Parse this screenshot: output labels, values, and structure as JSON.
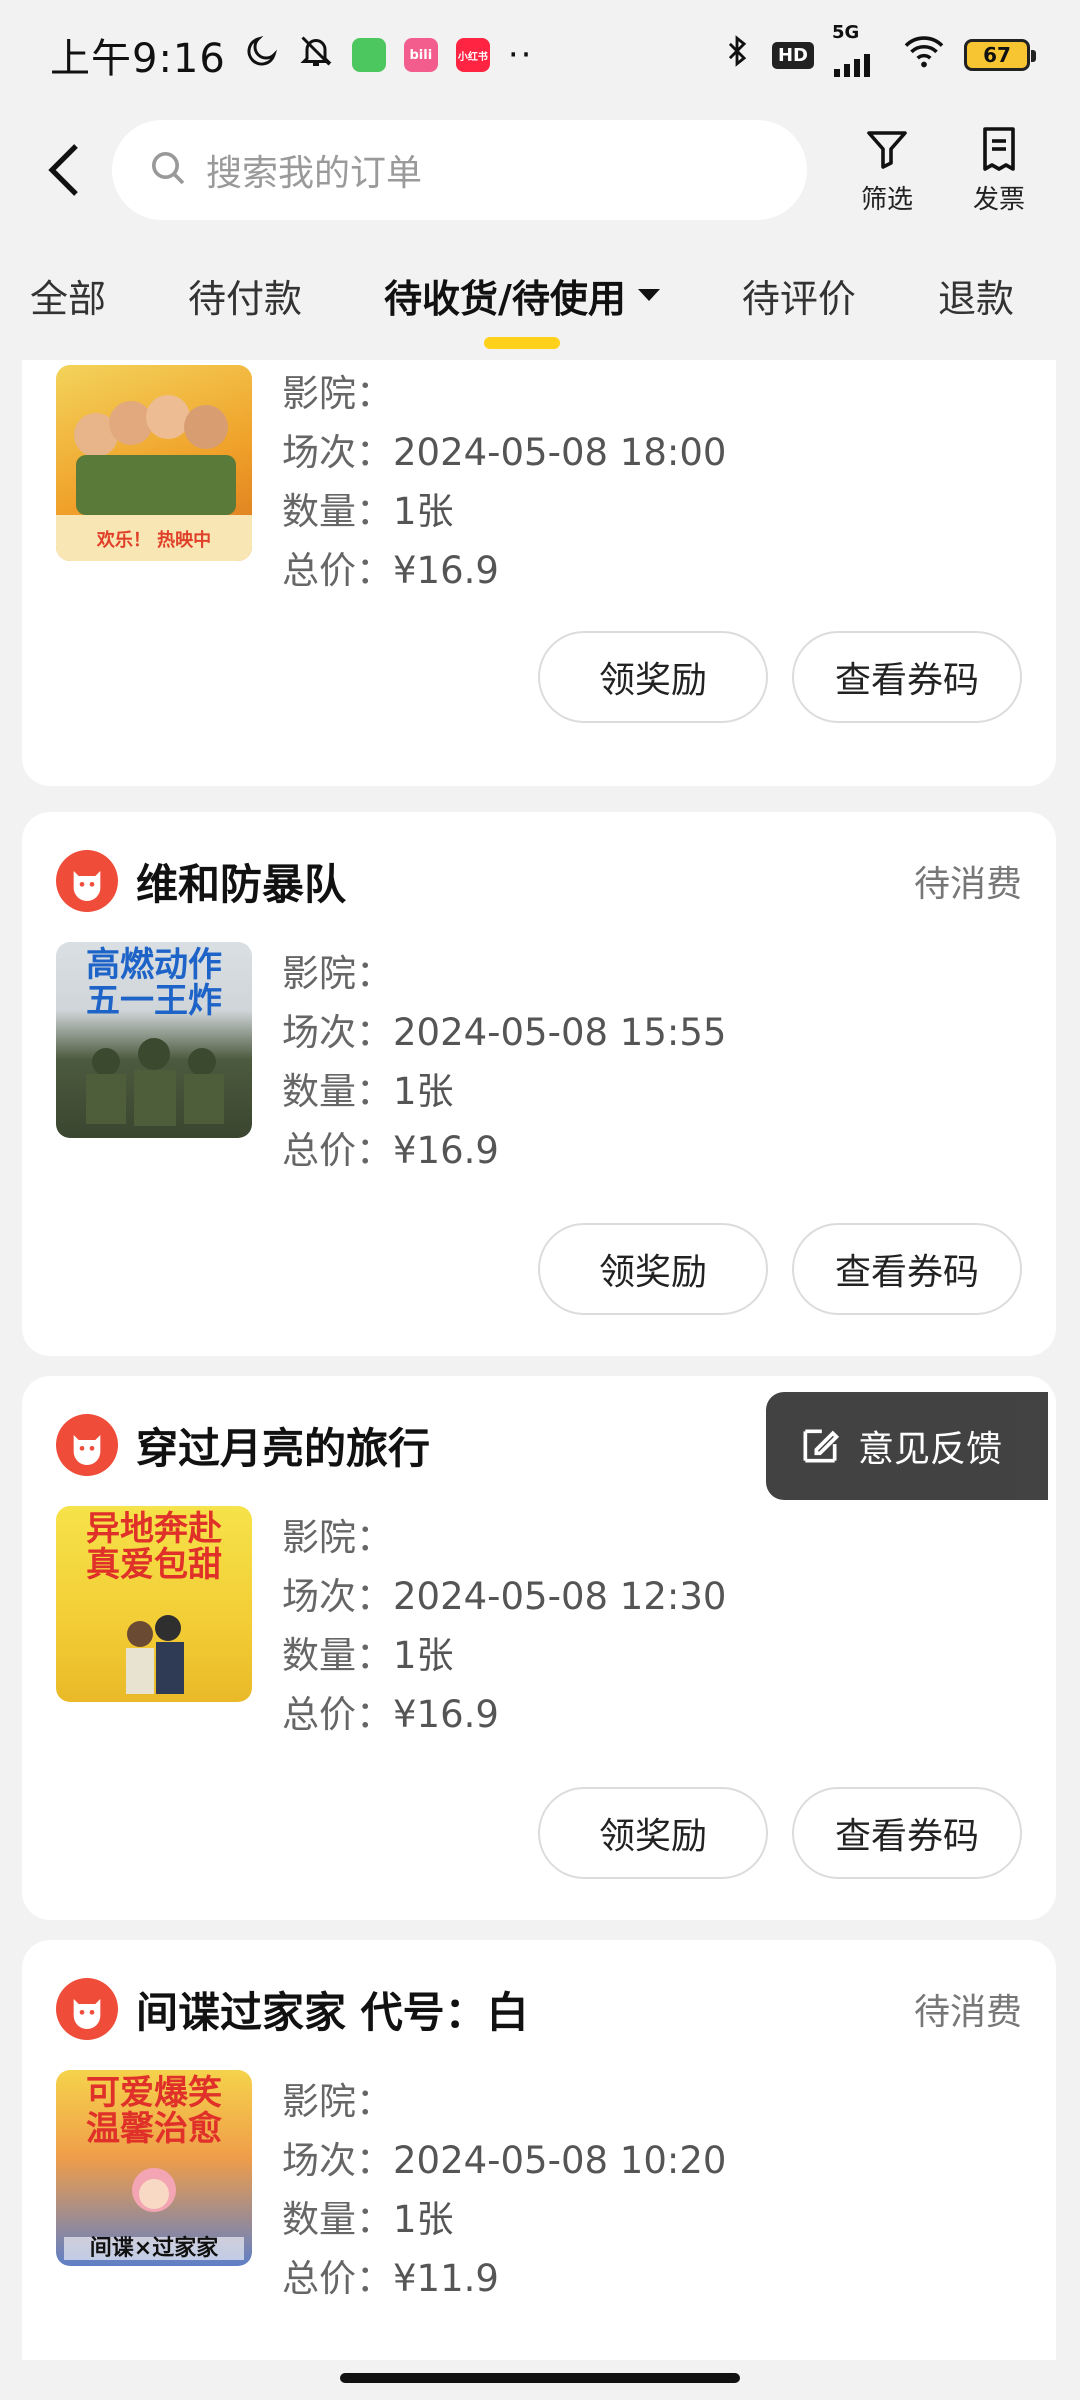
{
  "status_bar": {
    "time": "上午9:16",
    "network": "5G",
    "hd": "HD",
    "battery": "67",
    "more": "··",
    "app_chips": [
      {
        "name": "app-chip-green",
        "text": "",
        "color": "#4cc760"
      },
      {
        "name": "app-chip-pink",
        "text": "bili",
        "color": "#f25d8e"
      },
      {
        "name": "app-chip-red",
        "text": "小红书",
        "color": "#ff2442"
      }
    ]
  },
  "header": {
    "search_placeholder": "搜索我的订单",
    "filter_label": "筛选",
    "invoice_label": "发票"
  },
  "tabs": [
    "全部",
    "待付款",
    "待收货/待使用",
    "待评价",
    "退款"
  ],
  "orders": [
    {
      "title": "",
      "status": "",
      "poster_text": "欢乐！ 热映中",
      "cinema_label": "影院：",
      "cinema_value": "",
      "session_label": "场次：",
      "session_value": "2024-05-08 18:00",
      "qty_label": "数量：",
      "qty_value": "1张",
      "price_label": "总价：",
      "price_value": "¥16.9",
      "reward_btn": "领奖励",
      "code_btn": "查看券码"
    },
    {
      "title": "维和防暴队",
      "status": "待消费",
      "poster_text": "高燃动作 五一王炸",
      "cinema_label": "影院：",
      "cinema_value": "",
      "session_label": "场次：",
      "session_value": "2024-05-08 15:55",
      "qty_label": "数量：",
      "qty_value": "1张",
      "price_label": "总价：",
      "price_value": "¥16.9",
      "reward_btn": "领奖励",
      "code_btn": "查看券码"
    },
    {
      "title": "穿过月亮的旅行",
      "status": "",
      "poster_text": "异地奔赴 真爱包甜",
      "cinema_label": "影院：",
      "cinema_value": "",
      "session_label": "场次：",
      "session_value": "2024-05-08 12:30",
      "qty_label": "数量：",
      "qty_value": "1张",
      "price_label": "总价：",
      "price_value": "¥16.9",
      "reward_btn": "领奖励",
      "code_btn": "查看券码"
    },
    {
      "title": "间谍过家家 代号：白",
      "status": "待消费",
      "poster_text": "可爱爆笑 温馨治愈",
      "poster_subtext": "间谍×过家家",
      "cinema_label": "影院：",
      "cinema_value": "",
      "session_label": "场次：",
      "session_value": "2024-05-08 10:20",
      "qty_label": "数量：",
      "qty_value": "1张",
      "price_label": "总价：",
      "price_value": "¥11.9"
    }
  ],
  "feedback": {
    "label": "意见反馈"
  }
}
